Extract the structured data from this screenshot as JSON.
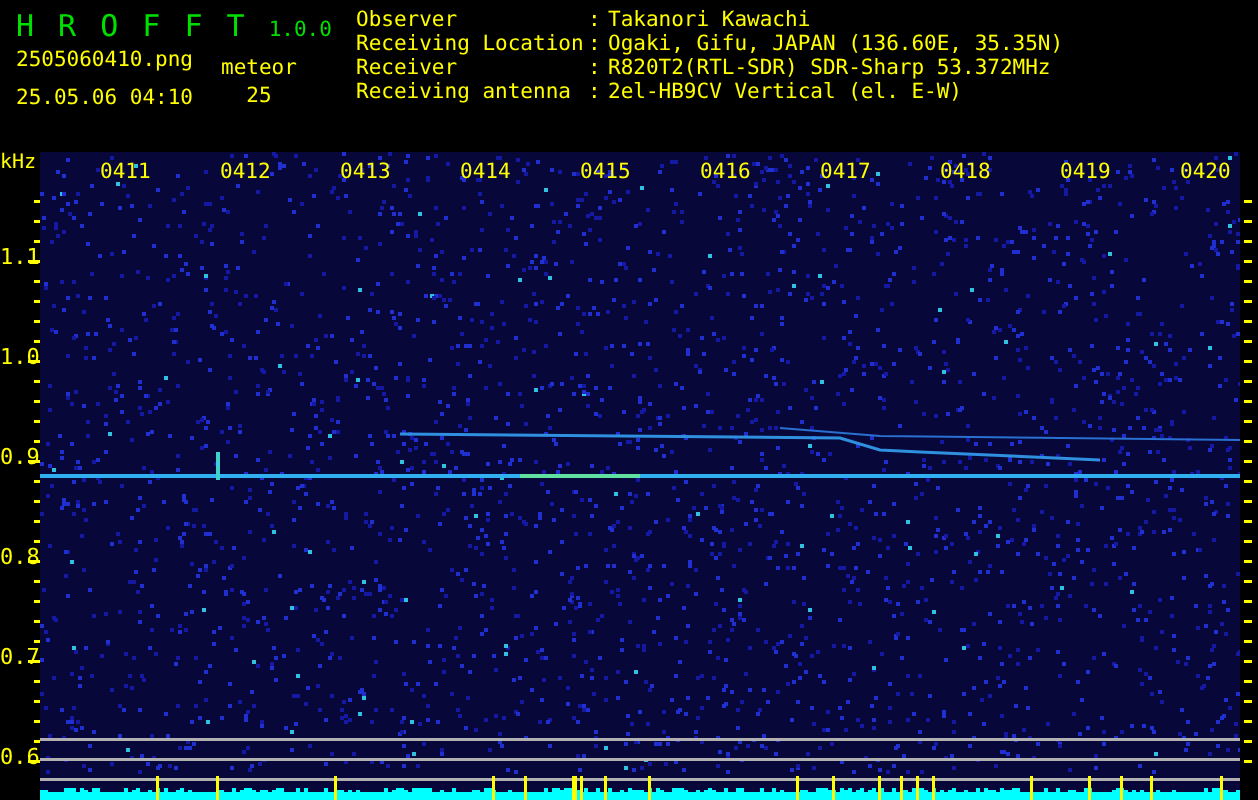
{
  "app": {
    "name": "H R O F F T",
    "version": "1.0.0",
    "filename": "2505060410.png",
    "datetime": "25.05.06 04:10",
    "meteor_label": "meteor",
    "meteor_count": "25"
  },
  "info": [
    {
      "label": "Observer",
      "separator": ":",
      "value": "Takanori Kawachi"
    },
    {
      "label": "Receiving Location",
      "separator": ":",
      "value": "Ogaki, Gifu, JAPAN (136.60E, 35.35N)"
    },
    {
      "label": "Receiver",
      "separator": ":",
      "value": "R820T2(RTL-SDR) SDR-Sharp 53.372MHz"
    },
    {
      "label": "Receiving antenna",
      "separator": ":",
      "value": "2el-HB9CV Vertical (el. E-W)"
    }
  ],
  "spectrogram": {
    "unit": "kHz",
    "time_labels": [
      "0411",
      "0412",
      "0413",
      "0414",
      "0415",
      "0416",
      "0417",
      "0418",
      "0419",
      "0420"
    ],
    "frequency_labels": [
      "1.1",
      "1.0",
      "0.9",
      "0.8",
      "0.7",
      "0.6"
    ]
  }
}
